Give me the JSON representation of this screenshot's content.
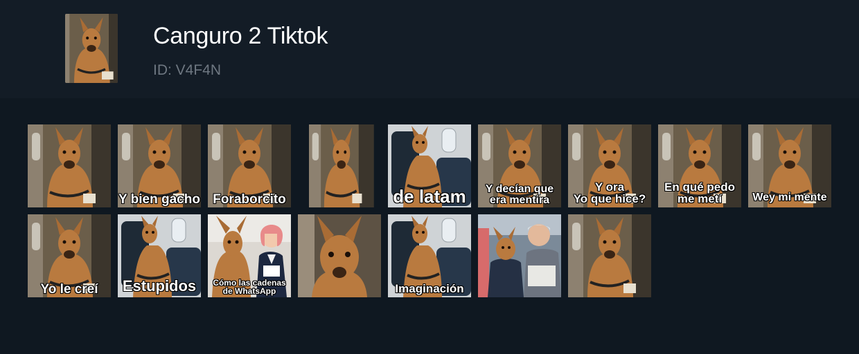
{
  "pack": {
    "title": "Canguro 2 Tiktok",
    "id_label": "ID: V4F4N",
    "thumbnail_icon": "kangaroo-sticker-image"
  },
  "colors": {
    "background": "#0f1821",
    "header": "#131c26",
    "title": "#ffffff",
    "id_text": "#6e7781",
    "kangaroo_fur": "#b97a3f"
  },
  "stickers": [
    {
      "caption": "",
      "scene": "plane-window"
    },
    {
      "caption": "Y bien gacho",
      "scene": "plane-window"
    },
    {
      "caption": "Foraborcito",
      "scene": "plane-window"
    },
    {
      "caption": "",
      "scene": "plane-window-cutout"
    },
    {
      "caption": "de latam",
      "scene": "plane-seat"
    },
    {
      "caption": "Y decían que\nera mentira",
      "scene": "plane-window"
    },
    {
      "caption": "Y ora\nYo que hice?",
      "scene": "plane-window"
    },
    {
      "caption": "En qué pedo\nme metí",
      "scene": "plane-window"
    },
    {
      "caption": "Wey mi mente",
      "scene": "plane-window"
    },
    {
      "caption": "Yo le creí",
      "scene": "plane-window"
    },
    {
      "caption": "Estupidos",
      "scene": "plane-seat"
    },
    {
      "caption": "Cómo las cadenas\nde WhatsApp",
      "scene": "flight-attendant"
    },
    {
      "caption": "",
      "scene": "closeup"
    },
    {
      "caption": "Imaginación",
      "scene": "plane-seat"
    },
    {
      "caption": "",
      "scene": "passengers"
    },
    {
      "caption": "",
      "scene": "plane-window"
    }
  ]
}
